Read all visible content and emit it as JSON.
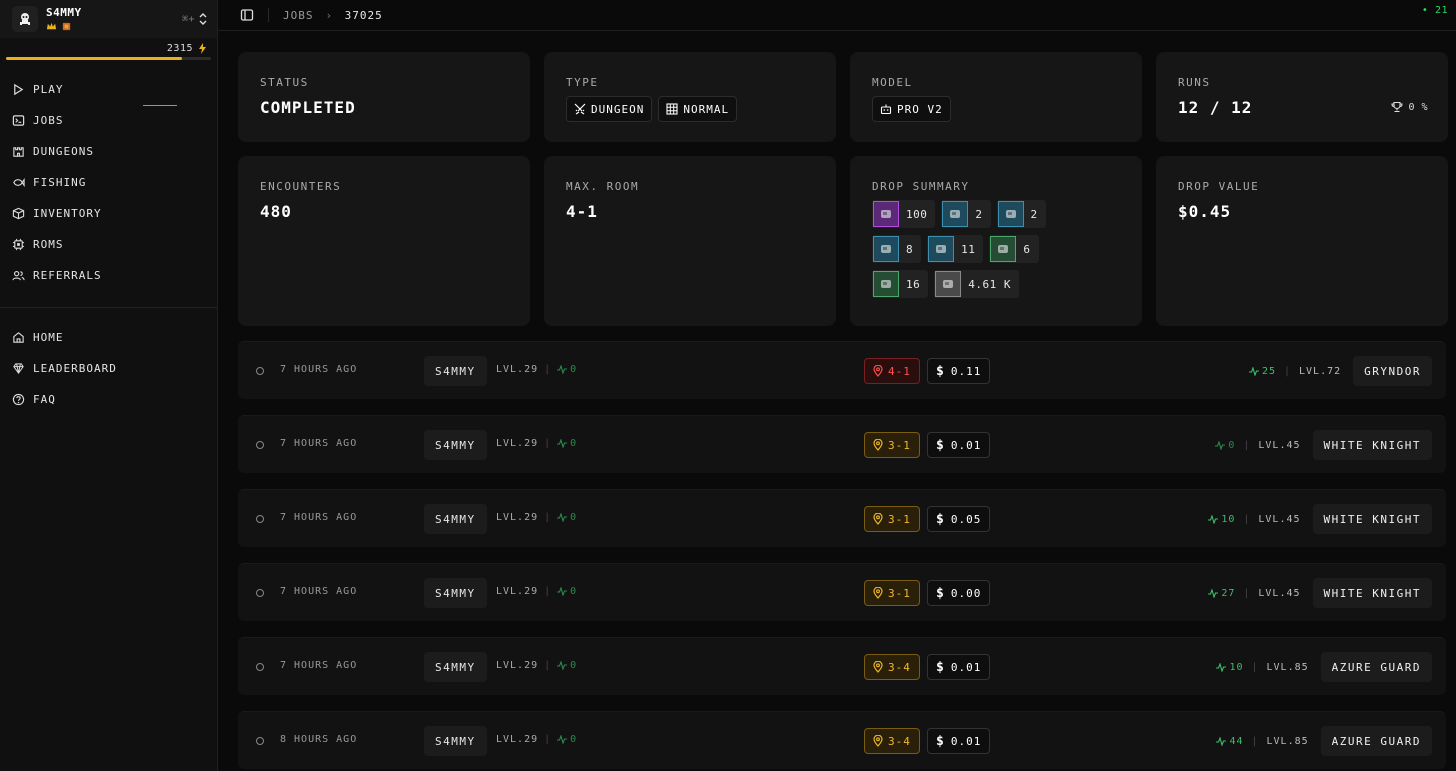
{
  "user": {
    "name": "S4MMY",
    "shortcut": "⌘+",
    "xp": "2315"
  },
  "nav": {
    "primary": [
      "PLAY",
      "JOBS",
      "DUNGEONS",
      "FISHING",
      "INVENTORY",
      "ROMS",
      "REFERRALS"
    ],
    "secondary": [
      "HOME",
      "LEADERBOARD",
      "FAQ"
    ]
  },
  "topbar": {
    "crumb_root": "JOBS",
    "crumb_current": "37025",
    "online": "• 21"
  },
  "cards": {
    "status": {
      "label": "STATUS",
      "value": "COMPLETED"
    },
    "type": {
      "label": "TYPE",
      "chips": [
        "DUNGEON",
        "NORMAL"
      ]
    },
    "model": {
      "label": "MODEL",
      "value": "PRO V2"
    },
    "runs": {
      "label": "RUNS",
      "value": "12 / 12",
      "win_rate": "0 %"
    },
    "encounters": {
      "label": "ENCOUNTERS",
      "value": "480"
    },
    "max_room": {
      "label": "MAX. ROOM",
      "value": "4-1"
    },
    "drop_summary": {
      "label": "DROP SUMMARY",
      "items": [
        {
          "count": "100",
          "icon": "cheese-icon",
          "border": "#b44be0",
          "bg": "#5a2a78"
        },
        {
          "count": "2",
          "icon": "crystal-icon",
          "border": "#3d8fb0",
          "bg": "#1d4a5c"
        },
        {
          "count": "2",
          "icon": "hourglass-icon",
          "border": "#3d8fb0",
          "bg": "#1d4a5c"
        },
        {
          "count": "8",
          "icon": "ore-icon",
          "border": "#3d8fb0",
          "bg": "#1d4a5c"
        },
        {
          "count": "11",
          "icon": "potion-icon",
          "border": "#3d8fb0",
          "bg": "#1d4a5c"
        },
        {
          "count": "6",
          "icon": "stone-icon",
          "border": "#4aa86a",
          "bg": "#244d33"
        },
        {
          "count": "16",
          "icon": "bone-icon",
          "border": "#4aa86a",
          "bg": "#244d33"
        },
        {
          "count": "4.61 K",
          "icon": "scrap-icon",
          "border": "#8a8a8a",
          "bg": "#4a4a4a"
        }
      ]
    },
    "drop_value": {
      "label": "DROP VALUE",
      "value": "$0.45"
    }
  },
  "runs": [
    {
      "time": "7 HOURS AGO",
      "player": "S4MMY",
      "level": "LVL.29",
      "player_pulse": "0",
      "room": "4-1",
      "room_color": "red",
      "value": "0.11",
      "mob_pulse": "25",
      "mob_level": "LVL.72",
      "mob": "GRYNDOR"
    },
    {
      "time": "7 HOURS AGO",
      "player": "S4MMY",
      "level": "LVL.29",
      "player_pulse": "0",
      "room": "3-1",
      "room_color": "gold",
      "value": "0.01",
      "mob_pulse": "0",
      "mob_level": "LVL.45",
      "mob": "WHITE KNIGHT"
    },
    {
      "time": "7 HOURS AGO",
      "player": "S4MMY",
      "level": "LVL.29",
      "player_pulse": "0",
      "room": "3-1",
      "room_color": "gold",
      "value": "0.05",
      "mob_pulse": "10",
      "mob_level": "LVL.45",
      "mob": "WHITE KNIGHT"
    },
    {
      "time": "7 HOURS AGO",
      "player": "S4MMY",
      "level": "LVL.29",
      "player_pulse": "0",
      "room": "3-1",
      "room_color": "gold",
      "value": "0.00",
      "mob_pulse": "27",
      "mob_level": "LVL.45",
      "mob": "WHITE KNIGHT"
    },
    {
      "time": "7 HOURS AGO",
      "player": "S4MMY",
      "level": "LVL.29",
      "player_pulse": "0",
      "room": "3-4",
      "room_color": "gold",
      "value": "0.01",
      "mob_pulse": "10",
      "mob_level": "LVL.85",
      "mob": "AZURE GUARD"
    },
    {
      "time": "8 HOURS AGO",
      "player": "S4MMY",
      "level": "LVL.29",
      "player_pulse": "0",
      "room": "3-4",
      "room_color": "gold",
      "value": "0.01",
      "mob_pulse": "44",
      "mob_level": "LVL.85",
      "mob": "AZURE GUARD"
    }
  ]
}
